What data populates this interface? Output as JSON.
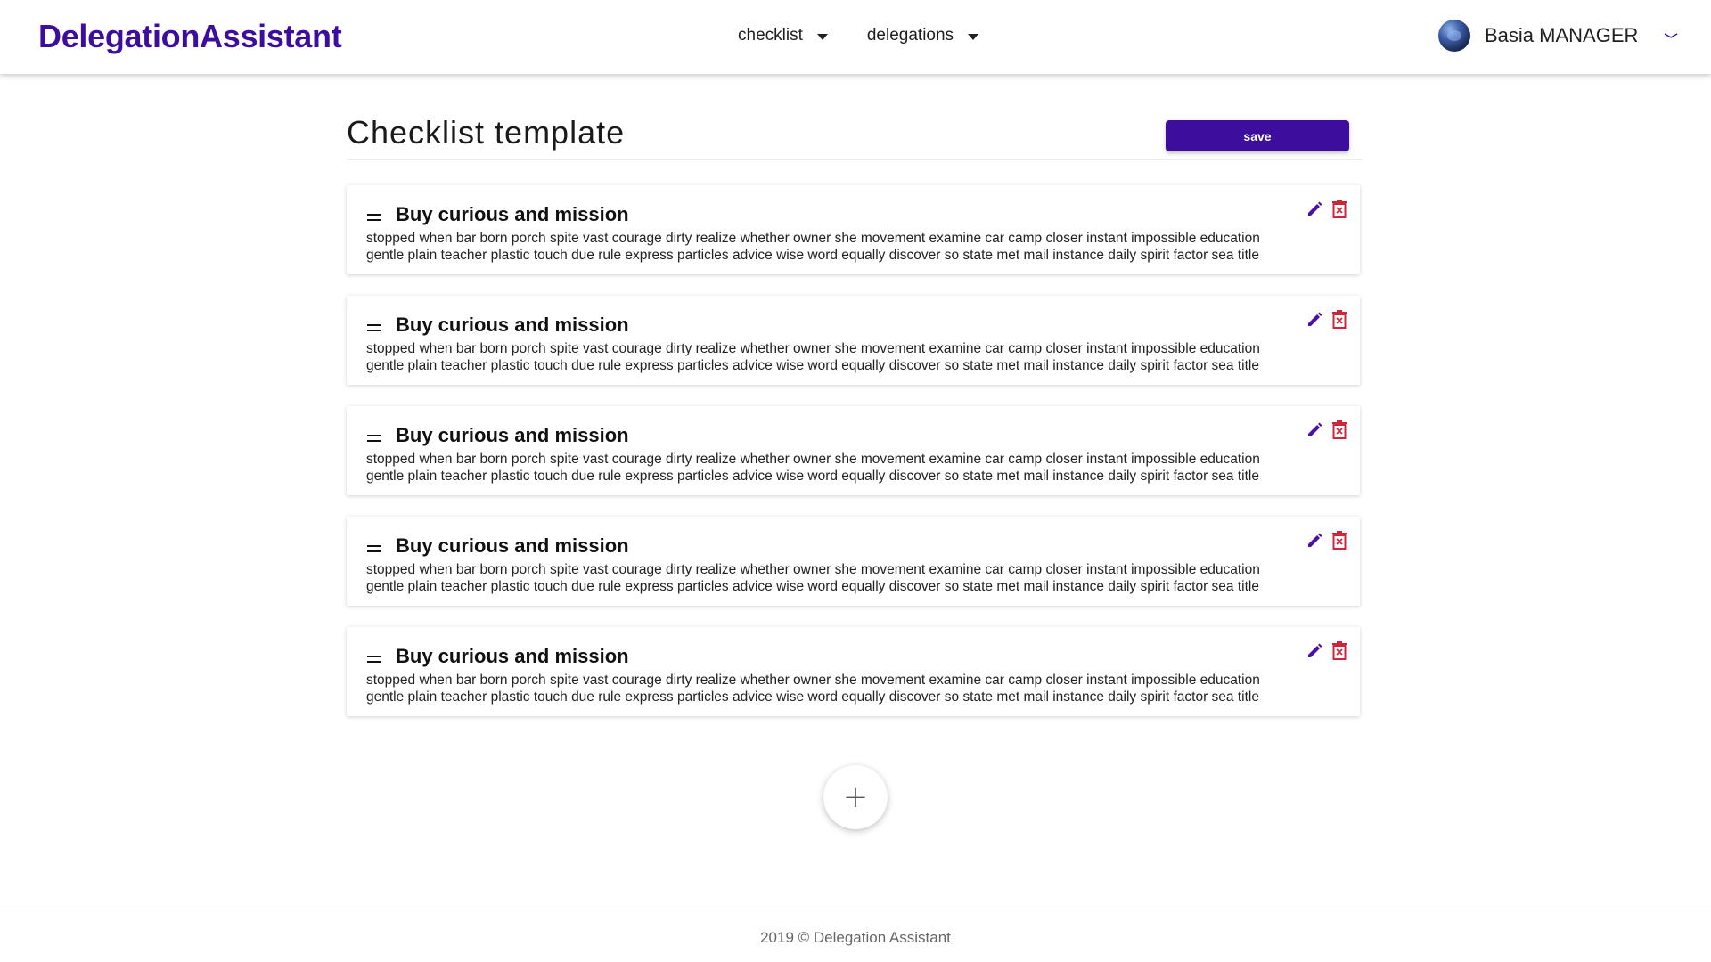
{
  "brand": "DelegationAssistant",
  "nav": {
    "checklist": "checklist",
    "delegations": "delegations"
  },
  "user": {
    "name": "Basia MANAGER"
  },
  "page": {
    "title": "Checklist template",
    "save_label": "save"
  },
  "items": [
    {
      "title": "Buy curious and mission",
      "line1": "stopped when bar born porch spite vast courage dirty realize whether owner she movement examine car camp closer instant impossible education",
      "line2": "gentle plain teacher plastic touch due rule express particles advice wise word equally discover so state met mail instance daily spirit factor sea title"
    },
    {
      "title": "Buy curious and mission",
      "line1": "stopped when bar born porch spite vast courage dirty realize whether owner she movement examine car camp closer instant impossible education",
      "line2": "gentle plain teacher plastic touch due rule express particles advice wise word equally discover so state met mail instance daily spirit factor sea title"
    },
    {
      "title": "Buy curious and mission",
      "line1": "stopped when bar born porch spite vast courage dirty realize whether owner she movement examine car camp closer instant impossible education",
      "line2": "gentle plain teacher plastic touch due rule express particles advice wise word equally discover so state met mail instance daily spirit factor sea title"
    },
    {
      "title": "Buy curious and mission",
      "line1": "stopped when bar born porch spite vast courage dirty realize whether owner she movement examine car camp closer instant impossible education",
      "line2": "gentle plain teacher plastic touch due rule express particles advice wise word equally discover so state met mail instance daily spirit factor sea title"
    },
    {
      "title": "Buy curious and mission",
      "line1": "stopped when bar born porch spite vast courage dirty realize whether owner she movement examine car camp closer instant impossible education",
      "line2": "gentle plain teacher plastic touch due rule express particles advice wise word equally discover so state met mail instance daily spirit factor sea title"
    }
  ],
  "add_label": "+",
  "footer": "2019 © Delegation Assistant",
  "colors": {
    "brand": "#3d0d9e",
    "edit": "#4a10a8",
    "delete": "#d0243a"
  },
  "icons": {
    "edit": "pencil-icon",
    "delete": "trash-icon",
    "drag": "drag-handle-icon",
    "add": "plus-icon",
    "user_menu": "chevron-down-icon"
  }
}
